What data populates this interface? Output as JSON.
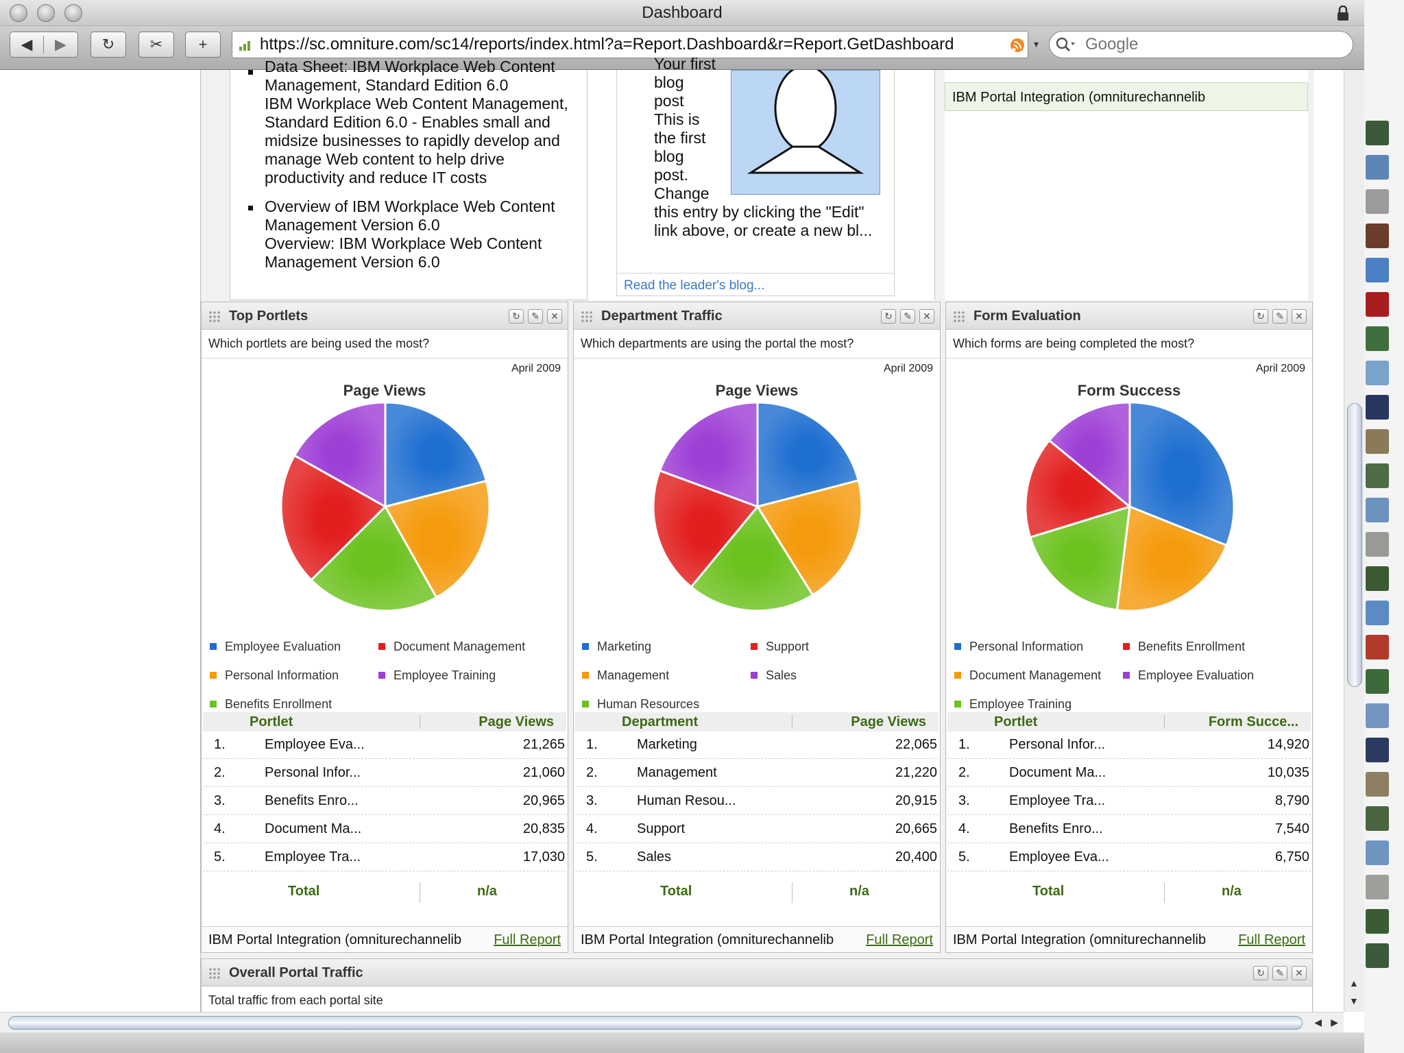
{
  "browser": {
    "window_title": "Dashboard",
    "url": "https://sc.omniture.com/sc14/reports/index.html?a=Report.Dashboard&r=Report.GetDashboard",
    "search_placeholder": "Google"
  },
  "top_section": {
    "article_items": [
      {
        "link": "Data Sheet: IBM Workplace Web Content Management, Standard Edition 6.0",
        "desc": "IBM Workplace Web Content Management, Standard Edition 6.0 - Enables small and midsize businesses to rapidly develop and manage Web content to help drive productivity and reduce IT costs"
      },
      {
        "link": "Overview of IBM Workplace Web Content Management Version 6.0",
        "desc": "Overview: IBM Workplace Web Content Management Version 6.0"
      }
    ],
    "blog": {
      "link_lines": [
        "Your first",
        "blog",
        "post"
      ],
      "body_lines": [
        "This is",
        "the first",
        "blog",
        "post.",
        "Change"
      ],
      "body_tail": "this entry by clicking the \"Edit\" link above, or create a new bl...",
      "read_more": "Read the leader's blog..."
    },
    "top_right_source": "IBM Portal Integration (omniturechannelib"
  },
  "cards": [
    {
      "title": "Top Portlets",
      "question": "Which portlets are being used the most?",
      "date": "April 2009",
      "chart_title": "Page Views",
      "col1": "Portlet",
      "col2": "Page Views",
      "rows": [
        {
          "num": "1.",
          "name": "Employee Eva...",
          "value": "21,265"
        },
        {
          "num": "2.",
          "name": "Personal Infor...",
          "value": "21,060"
        },
        {
          "num": "3.",
          "name": "Benefits Enro...",
          "value": "20,965"
        },
        {
          "num": "4.",
          "name": "Document Ma...",
          "value": "20,835"
        },
        {
          "num": "5.",
          "name": "Employee Tra...",
          "value": "17,030"
        }
      ],
      "total_label": "Total",
      "total_value": "n/a",
      "source": "IBM Portal Integration (omniturechannelib",
      "full_report": "Full Report"
    },
    {
      "title": "Department Traffic",
      "question": "Which departments are using the portal the most?",
      "date": "April 2009",
      "chart_title": "Page Views",
      "col1": "Department",
      "col2": "Page Views",
      "rows": [
        {
          "num": "1.",
          "name": "Marketing",
          "value": "22,065"
        },
        {
          "num": "2.",
          "name": "Management",
          "value": "21,220"
        },
        {
          "num": "3.",
          "name": "Human Resou...",
          "value": "20,915"
        },
        {
          "num": "4.",
          "name": "Support",
          "value": "20,665"
        },
        {
          "num": "5.",
          "name": "Sales",
          "value": "20,400"
        }
      ],
      "total_label": "Total",
      "total_value": "n/a",
      "source": "IBM Portal Integration (omniturechannelib",
      "full_report": "Full Report"
    },
    {
      "title": "Form Evaluation",
      "question": "Which forms are being completed the most?",
      "date": "April 2009",
      "chart_title": "Form Success",
      "col1": "Portlet",
      "col2": "Form Succe...",
      "rows": [
        {
          "num": "1.",
          "name": "Personal Infor...",
          "value": "14,920"
        },
        {
          "num": "2.",
          "name": "Document Ma...",
          "value": "10,035"
        },
        {
          "num": "3.",
          "name": "Employee Tra...",
          "value": "8,790"
        },
        {
          "num": "4.",
          "name": "Benefits Enro...",
          "value": "7,540"
        },
        {
          "num": "5.",
          "name": "Employee Eva...",
          "value": "6,750"
        }
      ],
      "total_label": "Total",
      "total_value": "n/a",
      "source": "IBM Portal Integration (omniturechannelib",
      "full_report": "Full Report"
    }
  ],
  "chart_data": [
    {
      "type": "pie",
      "title": "Page Views",
      "categories": [
        "Employee Evaluation",
        "Document Management",
        "Personal Information",
        "Employee Training",
        "Benefits Enrollment"
      ],
      "values": [
        21265,
        20835,
        21060,
        17030,
        20965
      ],
      "order": [
        "Employee Evaluation",
        "Personal Information",
        "Benefits Enrollment",
        "Document Management",
        "Employee Training"
      ],
      "colors": [
        "#1f6fd0",
        "#e21e1e",
        "#f59a0c",
        "#9e3fd6",
        "#6cc21f"
      ],
      "legend": "bottom"
    },
    {
      "type": "pie",
      "title": "Page Views",
      "categories": [
        "Marketing",
        "Support",
        "Management",
        "Sales",
        "Human Resources"
      ],
      "values": [
        22065,
        20665,
        21220,
        20400,
        20915
      ],
      "order": [
        "Marketing",
        "Management",
        "Human Resources",
        "Support",
        "Sales"
      ],
      "colors": [
        "#1f6fd0",
        "#e21e1e",
        "#f59a0c",
        "#9e3fd6",
        "#6cc21f"
      ],
      "legend": "bottom"
    },
    {
      "type": "pie",
      "title": "Form Success",
      "categories": [
        "Personal Information",
        "Benefits Enrollment",
        "Document Management",
        "Employee Evaluation",
        "Employee Training"
      ],
      "values": [
        14920,
        7540,
        10035,
        6750,
        8790
      ],
      "order": [
        "Personal Information",
        "Document Management",
        "Employee Training",
        "Benefits Enrollment",
        "Employee Evaluation"
      ],
      "colors": [
        "#1f6fd0",
        "#e21e1e",
        "#f59a0c",
        "#9e3fd6",
        "#6cc21f"
      ],
      "legend": "bottom"
    }
  ],
  "bottom_card": {
    "title": "Overall Portal Traffic",
    "question": "Total traffic from each portal site"
  }
}
